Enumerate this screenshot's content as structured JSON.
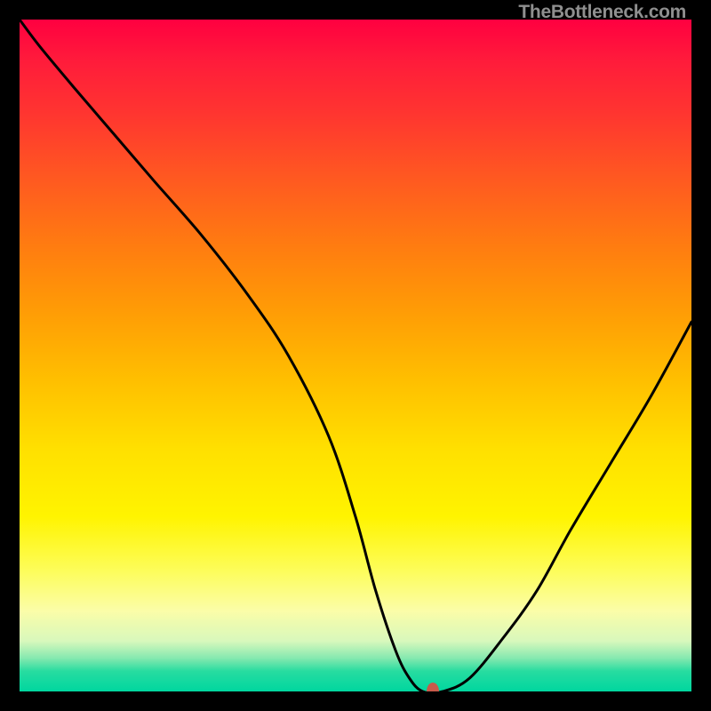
{
  "watermark": "TheBottleneck.com",
  "chart_data": {
    "type": "line",
    "title": "",
    "xlabel": "",
    "ylabel": "",
    "xlim": [
      0,
      100
    ],
    "ylim": [
      0,
      100
    ],
    "x": [
      0,
      3,
      8,
      14,
      20,
      27,
      34,
      40,
      46,
      50,
      53,
      56,
      58,
      60,
      63,
      67,
      72,
      77,
      82,
      88,
      94,
      100
    ],
    "values": [
      100,
      96,
      90,
      83,
      76,
      68,
      59,
      50,
      38,
      26,
      15,
      6,
      2,
      0,
      0,
      2,
      8,
      15,
      24,
      34,
      44,
      55
    ],
    "marker": {
      "x": 61.5,
      "y": 0
    },
    "background_gradient": {
      "stops": [
        {
          "pos": 0.0,
          "color": "#ff0040"
        },
        {
          "pos": 0.5,
          "color": "#ffd000"
        },
        {
          "pos": 0.85,
          "color": "#fcfd80"
        },
        {
          "pos": 1.0,
          "color": "#00d69f"
        }
      ]
    }
  }
}
